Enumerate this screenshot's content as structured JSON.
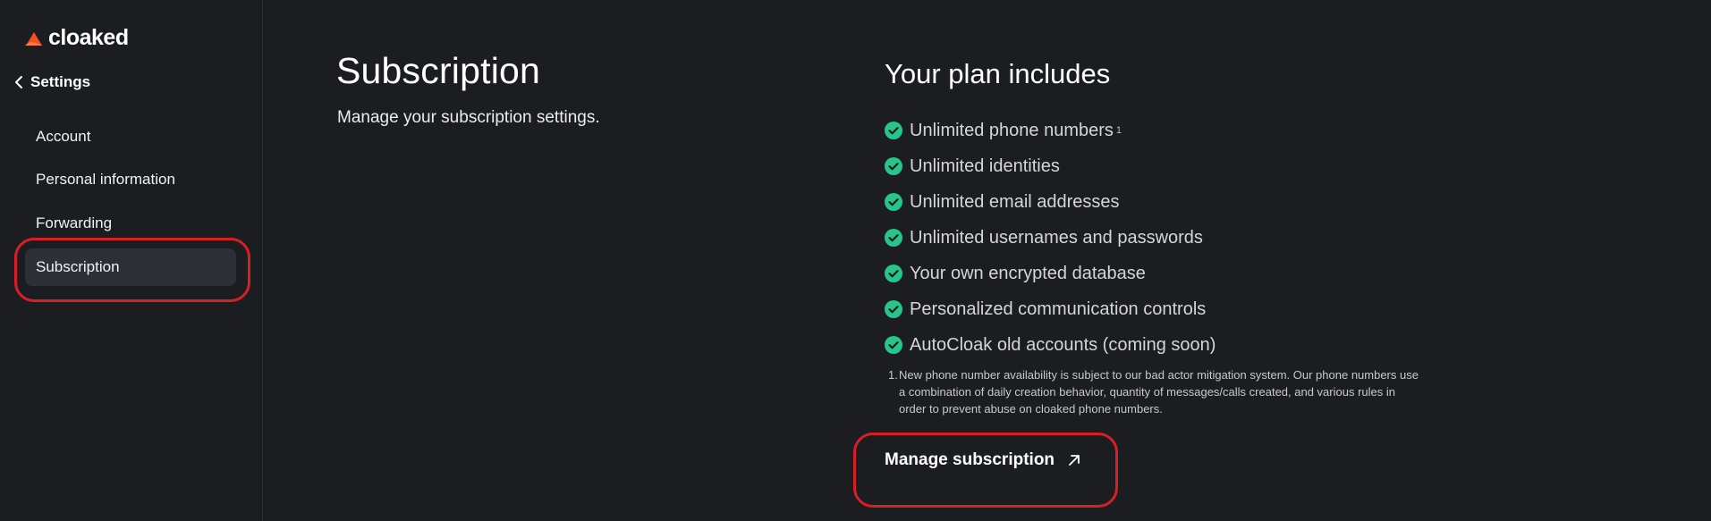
{
  "brand": {
    "name": "cloaked",
    "accent": "#f4511e"
  },
  "nav": {
    "back_label": "Settings",
    "items": [
      {
        "label": "Account"
      },
      {
        "label": "Personal information"
      },
      {
        "label": "Forwarding"
      },
      {
        "label": "Subscription",
        "active": true
      }
    ]
  },
  "page": {
    "title": "Subscription",
    "subtitle": "Manage your subscription settings."
  },
  "plan": {
    "title": "Your plan includes",
    "features": [
      {
        "label": "Unlimited phone numbers",
        "footnote_mark": "1"
      },
      {
        "label": "Unlimited identities"
      },
      {
        "label": "Unlimited email addresses"
      },
      {
        "label": "Unlimited usernames and passwords"
      },
      {
        "label": "Your own encrypted database"
      },
      {
        "label": "Personalized communication controls"
      },
      {
        "label": "AutoCloak old accounts (coming soon)"
      }
    ],
    "footnote": {
      "number": "1.",
      "text": "New phone number availability is subject to our bad actor mitigation system. Our phone numbers use a combination of daily creation behavior, quantity of messages/calls created, and various rules in order to prevent abuse on cloaked phone numbers."
    },
    "manage_label": "Manage subscription"
  },
  "colors": {
    "check": "#27c48b",
    "highlight": "#d81f26",
    "background": "#1b1d21"
  }
}
